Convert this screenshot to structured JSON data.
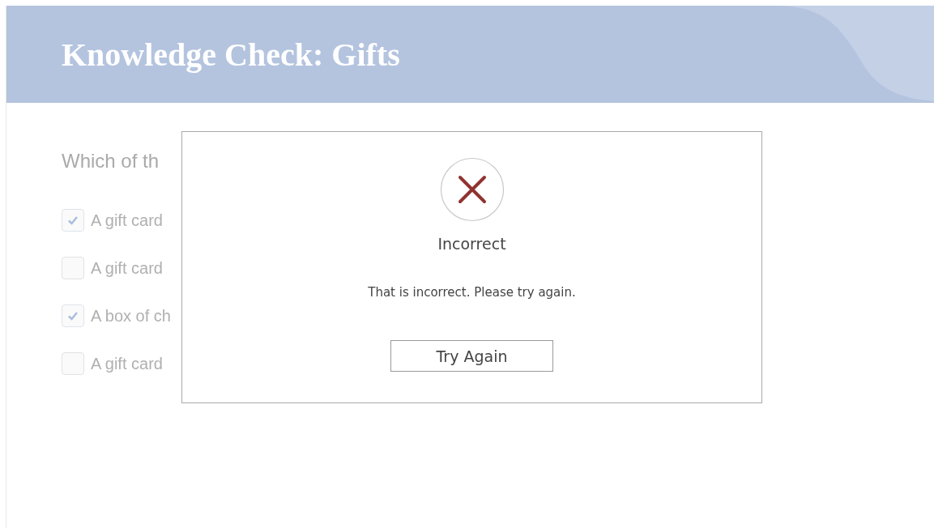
{
  "header": {
    "title": "Knowledge Check: Gifts"
  },
  "question": {
    "text": "Which of th"
  },
  "options": [
    {
      "label": "A gift card",
      "checked": true
    },
    {
      "label": "A gift card",
      "checked": false
    },
    {
      "label": "A box of ch",
      "checked": true
    },
    {
      "label": "A gift card",
      "checked": false
    }
  ],
  "dialog": {
    "title": "Incorrect",
    "message": "That is incorrect. Please try again.",
    "button": "Try Again"
  }
}
